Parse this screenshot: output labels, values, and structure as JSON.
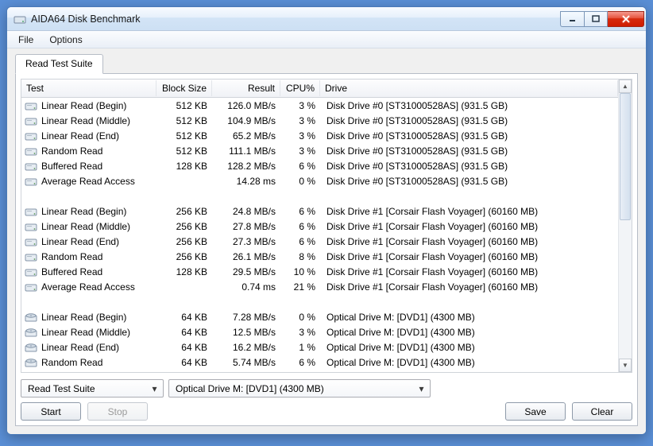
{
  "window": {
    "title": "AIDA64 Disk Benchmark"
  },
  "menu": {
    "file": "File",
    "options": "Options"
  },
  "tab": {
    "label": "Read Test Suite"
  },
  "columns": {
    "test": "Test",
    "block": "Block Size",
    "result": "Result",
    "cpu": "CPU%",
    "drive": "Drive"
  },
  "rows": [
    {
      "icon": "hdd",
      "test": "Linear Read (Begin)",
      "block": "512 KB",
      "result": "126.0 MB/s",
      "cpu": "3 %",
      "drive": "Disk Drive #0  [ST31000528AS]  (931.5 GB)"
    },
    {
      "icon": "hdd",
      "test": "Linear Read (Middle)",
      "block": "512 KB",
      "result": "104.9 MB/s",
      "cpu": "3 %",
      "drive": "Disk Drive #0  [ST31000528AS]  (931.5 GB)"
    },
    {
      "icon": "hdd",
      "test": "Linear Read (End)",
      "block": "512 KB",
      "result": "65.2 MB/s",
      "cpu": "3 %",
      "drive": "Disk Drive #0  [ST31000528AS]  (931.5 GB)"
    },
    {
      "icon": "hdd",
      "test": "Random Read",
      "block": "512 KB",
      "result": "111.1 MB/s",
      "cpu": "3 %",
      "drive": "Disk Drive #0  [ST31000528AS]  (931.5 GB)"
    },
    {
      "icon": "hdd",
      "test": "Buffered Read",
      "block": "128 KB",
      "result": "128.2 MB/s",
      "cpu": "6 %",
      "drive": "Disk Drive #0  [ST31000528AS]  (931.5 GB)"
    },
    {
      "icon": "hdd",
      "test": "Average Read Access",
      "block": "",
      "result": "14.28 ms",
      "cpu": "0 %",
      "drive": "Disk Drive #0  [ST31000528AS]  (931.5 GB)"
    },
    {
      "spacer": true
    },
    {
      "icon": "hdd",
      "test": "Linear Read (Begin)",
      "block": "256 KB",
      "result": "24.8 MB/s",
      "cpu": "6 %",
      "drive": "Disk Drive #1  [Corsair Flash Voyager]  (60160 MB)"
    },
    {
      "icon": "hdd",
      "test": "Linear Read (Middle)",
      "block": "256 KB",
      "result": "27.8 MB/s",
      "cpu": "6 %",
      "drive": "Disk Drive #1  [Corsair Flash Voyager]  (60160 MB)"
    },
    {
      "icon": "hdd",
      "test": "Linear Read (End)",
      "block": "256 KB",
      "result": "27.3 MB/s",
      "cpu": "6 %",
      "drive": "Disk Drive #1  [Corsair Flash Voyager]  (60160 MB)"
    },
    {
      "icon": "hdd",
      "test": "Random Read",
      "block": "256 KB",
      "result": "26.1 MB/s",
      "cpu": "8 %",
      "drive": "Disk Drive #1  [Corsair Flash Voyager]  (60160 MB)"
    },
    {
      "icon": "hdd",
      "test": "Buffered Read",
      "block": "128 KB",
      "result": "29.5 MB/s",
      "cpu": "10 %",
      "drive": "Disk Drive #1  [Corsair Flash Voyager]  (60160 MB)"
    },
    {
      "icon": "hdd",
      "test": "Average Read Access",
      "block": "",
      "result": "0.74 ms",
      "cpu": "21 %",
      "drive": "Disk Drive #1  [Corsair Flash Voyager]  (60160 MB)"
    },
    {
      "spacer": true
    },
    {
      "icon": "optical",
      "test": "Linear Read (Begin)",
      "block": "64 KB",
      "result": "7.28 MB/s",
      "cpu": "0 %",
      "drive": "Optical Drive M:  [DVD1]  (4300 MB)"
    },
    {
      "icon": "optical",
      "test": "Linear Read (Middle)",
      "block": "64 KB",
      "result": "12.5 MB/s",
      "cpu": "3 %",
      "drive": "Optical Drive M:  [DVD1]  (4300 MB)"
    },
    {
      "icon": "optical",
      "test": "Linear Read (End)",
      "block": "64 KB",
      "result": "16.2 MB/s",
      "cpu": "1 %",
      "drive": "Optical Drive M:  [DVD1]  (4300 MB)"
    },
    {
      "icon": "optical",
      "test": "Random Read",
      "block": "64 KB",
      "result": "5.74 MB/s",
      "cpu": "6 %",
      "drive": "Optical Drive M:  [DVD1]  (4300 MB)"
    }
  ],
  "controls": {
    "testSuite": "Read Test Suite",
    "driveSelect": "Optical Drive M:  [DVD1]  (4300 MB)",
    "start": "Start",
    "stop": "Stop",
    "save": "Save",
    "clear": "Clear"
  }
}
